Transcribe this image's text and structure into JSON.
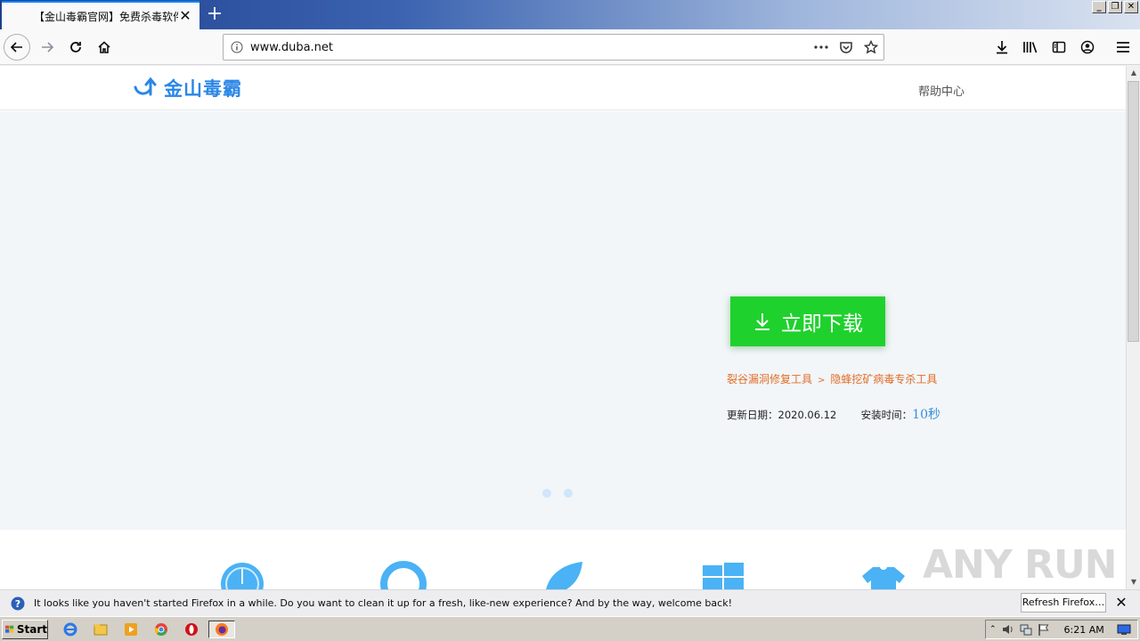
{
  "browser": {
    "tab_title": "【金山毒霸官网】免费杀毒软件|E",
    "url": "www.duba.net",
    "page_actions": [
      "more-icon",
      "pocket-icon",
      "bookmark-star-icon"
    ],
    "toolbar_icons": [
      "download-icon",
      "library-icon",
      "sidebar-icon",
      "account-icon",
      "menu-icon"
    ]
  },
  "site": {
    "logo_text": "金山毒霸",
    "help_link": "帮助中心",
    "download_label": "立即下载",
    "tool_link_1": "裂谷漏洞修复工具",
    "tool_sep": ">",
    "tool_link_2": "隐蜂挖矿病毒专杀工具",
    "update_label": "更新日期：",
    "update_date": "2020.06.12",
    "install_label": "安装时间：",
    "install_time": "10秒",
    "accent_color": "#2a86e6",
    "download_color": "#1fd12d"
  },
  "notification": {
    "text": "It looks like you haven't started Firefox in a while. Do you want to clean it up for a fresh, like-new experience? And by the way, welcome back!",
    "button": "Refresh Firefox…"
  },
  "taskbar": {
    "start_label": "Start",
    "clock": "6:21 AM",
    "apps": [
      "ie-icon",
      "explorer-icon",
      "media-player-icon",
      "chrome-icon",
      "opera-icon",
      "firefox-icon"
    ]
  },
  "watermark": "ANY RUN"
}
